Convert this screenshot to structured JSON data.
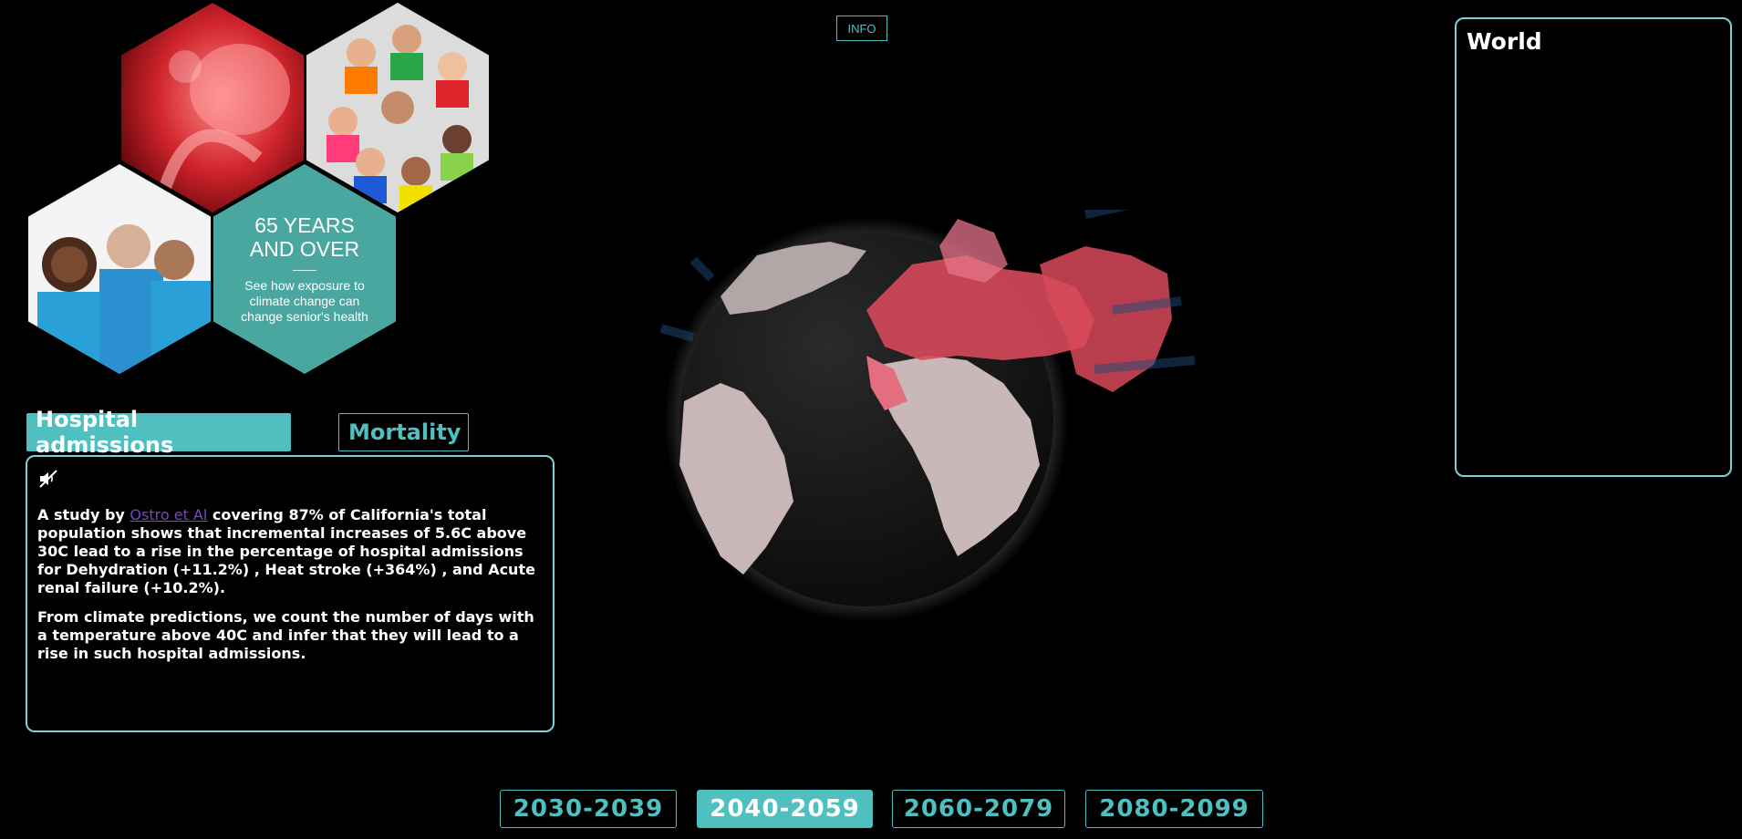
{
  "header": {
    "info_label": "INFO"
  },
  "hex_card": {
    "title": "65 YEARS AND OVER",
    "subtitle": "See how exposure to climate change can change senior's health"
  },
  "tabs": [
    {
      "label": "Hospital admissions",
      "active": true
    },
    {
      "label": "Mortality",
      "active": false
    }
  ],
  "info_panel": {
    "mute_icon": "speaker-muted-icon",
    "p1_prefix": "A study by ",
    "p1_link": "Ostro et Al",
    "p1_suffix": " covering 87% of California's total population shows that incremental increases of 5.6C above 30C lead to a rise in the percentage of hospital admissions for Dehydration (+11.2%) , Heat stroke (+364%) , and Acute renal failure (+10.2%).",
    "p2": "From climate predictions, we count the number of days with a temperature above 40C and infer that they will lead to a rise in such hospital admissions."
  },
  "world_panel": {
    "title": "World"
  },
  "decades": [
    {
      "label": "2030-2039",
      "active": false
    },
    {
      "label": "2040-2059",
      "active": true
    },
    {
      "label": "2060-2079",
      "active": false
    },
    {
      "label": "2080-2099",
      "active": false
    }
  ],
  "colors": {
    "accent": "#4fbfc0",
    "hot": "#e0505e",
    "link": "#7a46c8"
  }
}
